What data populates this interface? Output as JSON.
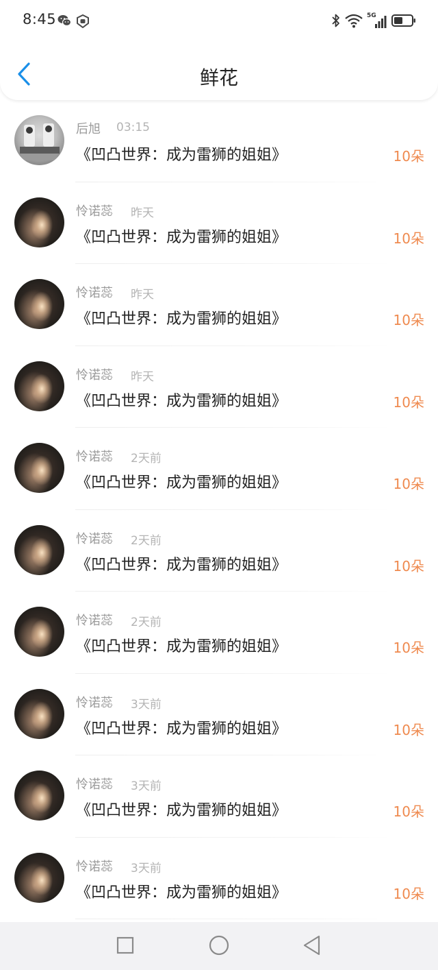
{
  "status_bar": {
    "time": "8:45",
    "left_icons": [
      "wechat-icon",
      "shield-app-icon"
    ],
    "right_icons": [
      "bluetooth-icon",
      "wifi-icon",
      "signal-5g-icon",
      "battery-icon"
    ],
    "network_label": "5G"
  },
  "header": {
    "title": "鲜花",
    "back_icon": "chevron-left-icon",
    "accent_color": "#1a8fe8"
  },
  "list": {
    "items": [
      {
        "user": "后旭",
        "time": "03:15",
        "title": "《凹凸世界：成为雷狮的姐姐》",
        "count": "10朵",
        "avatar": "gray-photo"
      },
      {
        "user": "怜诺蕊",
        "time": "昨天",
        "title": "《凹凸世界：成为雷狮的姐姐》",
        "count": "10朵",
        "avatar": "dark-photo"
      },
      {
        "user": "怜诺蕊",
        "time": "昨天",
        "title": "《凹凸世界：成为雷狮的姐姐》",
        "count": "10朵",
        "avatar": "dark-photo"
      },
      {
        "user": "怜诺蕊",
        "time": "昨天",
        "title": "《凹凸世界：成为雷狮的姐姐》",
        "count": "10朵",
        "avatar": "dark-photo"
      },
      {
        "user": "怜诺蕊",
        "time": "2天前",
        "title": "《凹凸世界：成为雷狮的姐姐》",
        "count": "10朵",
        "avatar": "dark-photo"
      },
      {
        "user": "怜诺蕊",
        "time": "2天前",
        "title": "《凹凸世界：成为雷狮的姐姐》",
        "count": "10朵",
        "avatar": "dark-photo"
      },
      {
        "user": "怜诺蕊",
        "time": "2天前",
        "title": "《凹凸世界：成为雷狮的姐姐》",
        "count": "10朵",
        "avatar": "dark-photo"
      },
      {
        "user": "怜诺蕊",
        "time": "3天前",
        "title": "《凹凸世界：成为雷狮的姐姐》",
        "count": "10朵",
        "avatar": "dark-photo"
      },
      {
        "user": "怜诺蕊",
        "time": "3天前",
        "title": "《凹凸世界：成为雷狮的姐姐》",
        "count": "10朵",
        "avatar": "dark-photo"
      },
      {
        "user": "怜诺蕊",
        "time": "3天前",
        "title": "《凹凸世界：成为雷狮的姐姐》",
        "count": "10朵",
        "avatar": "dark-photo"
      }
    ],
    "count_color": "#ef8a4f"
  },
  "nav_bar": {
    "buttons": [
      "recent-apps-icon",
      "home-icon",
      "back-icon"
    ]
  }
}
